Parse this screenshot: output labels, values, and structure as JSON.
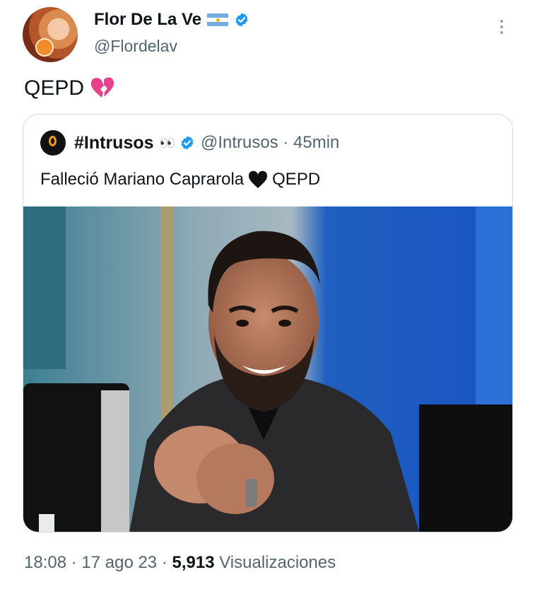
{
  "author": {
    "name": "Flor De La Ve",
    "handle": "@Flordelav",
    "avatar_icon": "profile-photo",
    "flag_icon": "argentina-flag-icon",
    "verified_icon": "verified-badge-icon"
  },
  "tweet": {
    "text": "QEPD",
    "emoji_icon": "broken-heart-icon"
  },
  "quoted": {
    "name": "#Intrusos",
    "eyes": "👀",
    "handle": "@Intrusos · 45min",
    "text_before": "Falleció Mariano Caprarola",
    "emoji_icon": "black-heart-icon",
    "text_after": "QEPD",
    "image_icon": "photo-of-smiling-man"
  },
  "meta": {
    "time_date": "18:08 · 17 ago 23 · ",
    "views_count": "5,913",
    "views_label": " Visualizaciones"
  },
  "colors": {
    "verified": "#1d9bf0",
    "secondary_text": "#536471",
    "border": "#cfd9de"
  }
}
